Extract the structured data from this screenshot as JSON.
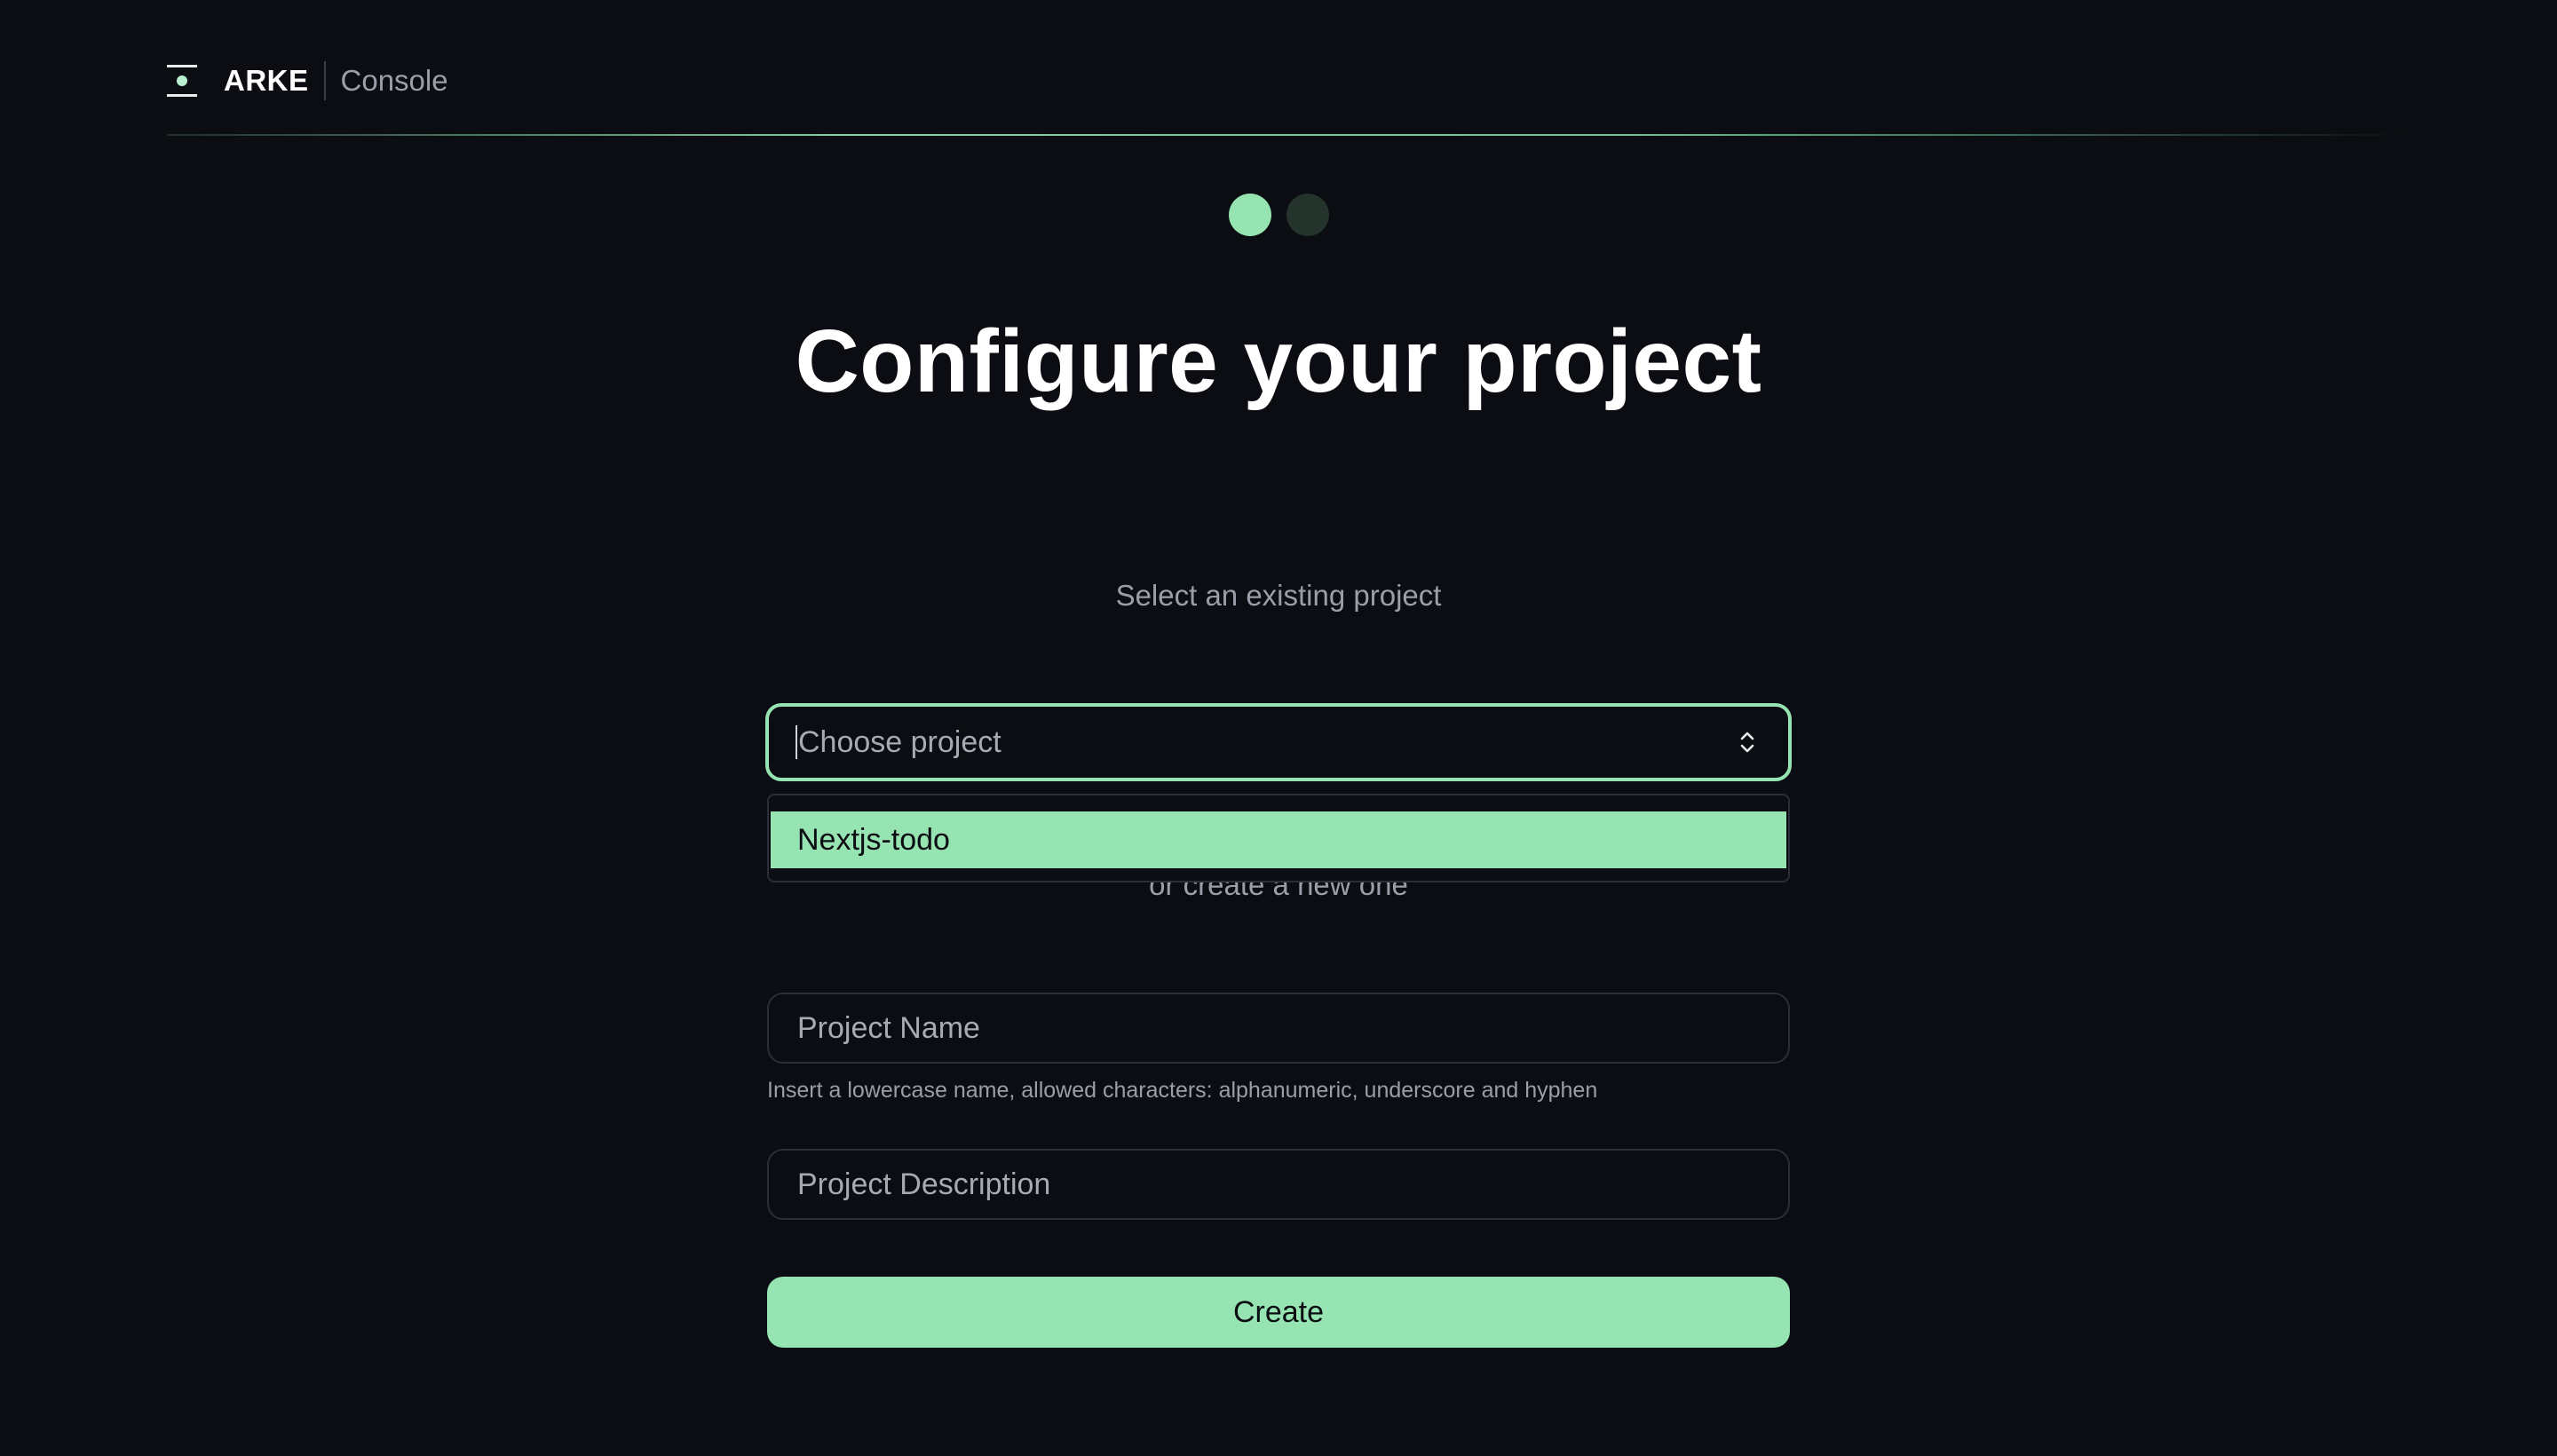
{
  "header": {
    "brand": "ARKE",
    "sub": "Console"
  },
  "steps": {
    "current": 1,
    "total": 2
  },
  "title": "Configure your project",
  "select_section": {
    "label": "Select an existing project",
    "placeholder": "Choose project",
    "options": [
      "Nextjs-todo"
    ]
  },
  "create_section": {
    "label": "or create a new one",
    "name_placeholder": "Project Name",
    "name_hint": "Insert a lowercase name, allowed characters: alphanumeric, underscore and hyphen",
    "description_placeholder": "Project Description",
    "button_label": "Create"
  },
  "colors": {
    "background": "#0b0d12",
    "accent": "#95e4b2",
    "step_inactive": "#24332c",
    "muted_text": "#9a9ea8"
  },
  "icons": {
    "logo": "arke-logo-icon",
    "select_toggle": "chevron-up-down-icon"
  }
}
